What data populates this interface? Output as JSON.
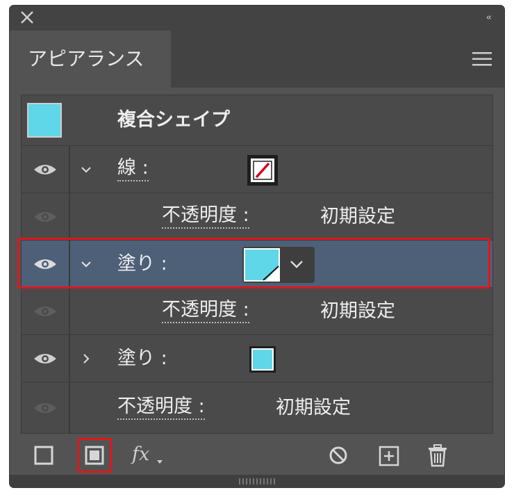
{
  "panel": {
    "tab_label": "アピアランス"
  },
  "header_row": {
    "title": "複合シェイプ",
    "swatch_color": "#5fd7e8"
  },
  "rows": {
    "stroke": {
      "label": "線 :",
      "swatch": "stroke-none-red-slash",
      "expanded": true
    },
    "stroke_opacity": {
      "label": "不透明度 :",
      "value": "初期設定"
    },
    "fill1": {
      "label": "塗り :",
      "swatch_color": "#5fd7e8",
      "expanded": true,
      "selected": true
    },
    "fill1_opacity": {
      "label": "不透明度 :",
      "value": "初期設定"
    },
    "fill2": {
      "label": "塗り :",
      "swatch_color": "#5fd7e8",
      "expanded": false
    },
    "object_opacity": {
      "label": "不透明度 :",
      "value": "初期設定"
    }
  },
  "footer": {
    "fx_label": "fx",
    "icons": [
      "add-stroke-icon",
      "add-fill-icon",
      "fx-icon",
      "clear-appearance-icon",
      "duplicate-item-icon",
      "delete-item-icon"
    ]
  },
  "colors": {
    "panel_bg": "#535353",
    "selection": "#4d6078",
    "highlight_red": "#e0161c",
    "cyan": "#5fd7e8"
  }
}
